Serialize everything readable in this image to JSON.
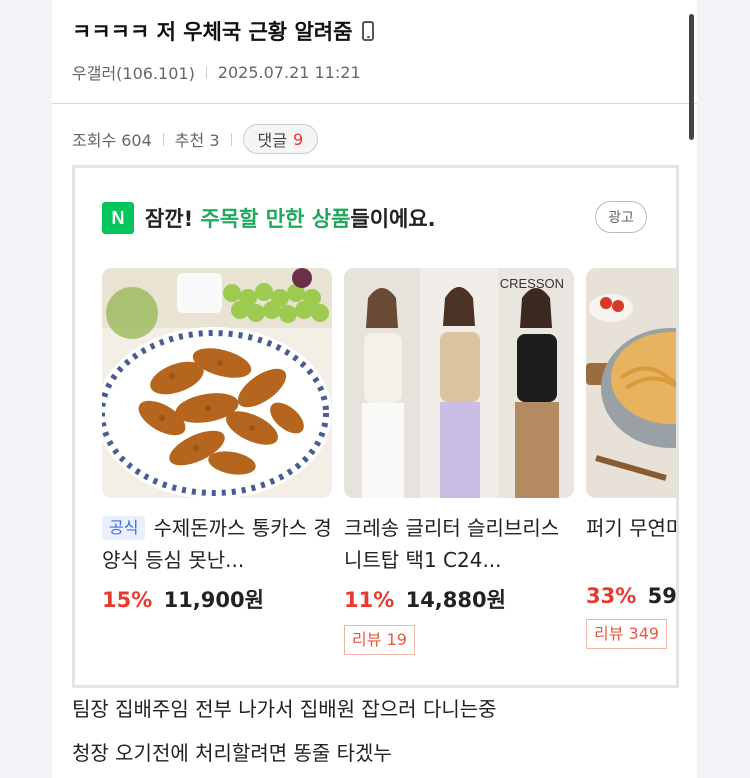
{
  "post": {
    "title": "ㅋㅋㅋㅋ 저 우체국 근황 알려줌",
    "author": "우갤러(106.101)",
    "datetime": "2025.07.21 11:21",
    "views": "조회수 604",
    "recommends": "추천 3",
    "comments_label": "댓글",
    "comments_count": "9",
    "body_lines": [
      "팀장 집배주임 전부 나가서 집배원 잡으러 다니는중",
      "청장 오기전에 처리할려면 똥줄 타겠누"
    ]
  },
  "ad": {
    "logo": "N",
    "heading_prefix": "잠깐!",
    "heading_highlight": "주목할 만한 상품",
    "heading_suffix": "들이에요.",
    "badge": "광고",
    "products": [
      {
        "official_tag": "공식",
        "name": "수제돈까스 통카스 경양식 등심 못난...",
        "discount": "15%",
        "price": "11,900원",
        "review": ""
      },
      {
        "official_tag": "",
        "name": "크레송 글리터 슬리브리스 니트탑 택1 C24...",
        "discount": "11%",
        "price": "14,880원",
        "review": "리뷰 19",
        "image_text": "CRESSON"
      },
      {
        "official_tag": "",
        "name": "퍼기 무연마 스",
        "discount": "33%",
        "price": "59",
        "review": "리뷰 349"
      }
    ]
  },
  "icons": [
    "phone-icon"
  ],
  "colors": {
    "naver_green": "#03c75a",
    "highlight_green": "#1ea85c",
    "discount_red": "#e8392e",
    "comment_count_red": "#ee3333"
  }
}
